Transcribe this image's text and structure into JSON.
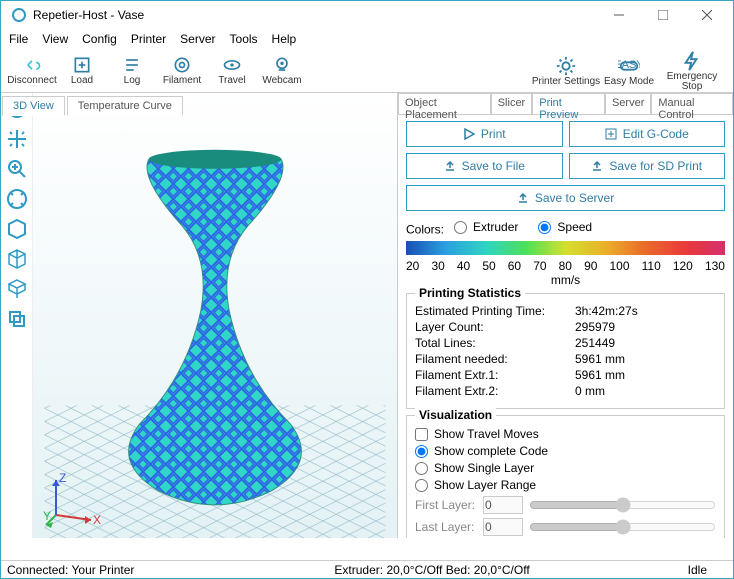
{
  "window": {
    "title": "Repetier-Host - Vase"
  },
  "menu": [
    "File",
    "View",
    "Config",
    "Printer",
    "Server",
    "Tools",
    "Help"
  ],
  "toolbar": {
    "disconnect": "Disconnect",
    "load": "Load",
    "log": "Log",
    "filament": "Filament",
    "travel": "Travel",
    "webcam": "Webcam",
    "printer_settings": "Printer Settings",
    "easy_mode": "Easy Mode",
    "emergency": "Emergency Stop"
  },
  "left_tabs": {
    "view3d": "3D View",
    "temp_curve": "Temperature Curve"
  },
  "right_tabs": {
    "object_placement": "Object Placement",
    "slicer": "Slicer",
    "print_preview": "Print Preview",
    "server": "Server",
    "manual_control": "Manual Control"
  },
  "buttons": {
    "print": "Print",
    "edit_gcode": "Edit G-Code",
    "save_file": "Save to File",
    "save_sd": "Save for SD Print",
    "save_server": "Save to Server"
  },
  "colors": {
    "label": "Colors:",
    "extruder": "Extruder",
    "speed": "Speed",
    "unit": "mm/s",
    "ticks": [
      "20",
      "30",
      "40",
      "50",
      "60",
      "70",
      "80",
      "90",
      "100",
      "110",
      "120",
      "130"
    ]
  },
  "stats": {
    "title": "Printing Statistics",
    "rows": [
      {
        "k": "Estimated Printing Time:",
        "v": "3h:42m:27s"
      },
      {
        "k": "Layer Count:",
        "v": "295979"
      },
      {
        "k": "Total Lines:",
        "v": "251449"
      },
      {
        "k": "Filament needed:",
        "v": "5961 mm"
      },
      {
        "k": "Filament Extr.1:",
        "v": "5961 mm"
      },
      {
        "k": "Filament Extr.2:",
        "v": "0 mm"
      }
    ]
  },
  "viz": {
    "title": "Visualization",
    "show_travel": "Show Travel Moves",
    "show_complete": "Show complete Code",
    "show_single": "Show Single Layer",
    "show_range": "Show Layer Range",
    "first_layer": "First Layer:",
    "last_layer": "Last Layer:",
    "first_val": "0",
    "last_val": "0"
  },
  "status": {
    "conn": "Connected: Your Printer",
    "ext": "Extruder: 20,0°C/Off Bed: 20,0°C/Off",
    "idle": "Idle"
  },
  "axes": {
    "x": "X",
    "y": "Y",
    "z": "Z"
  }
}
